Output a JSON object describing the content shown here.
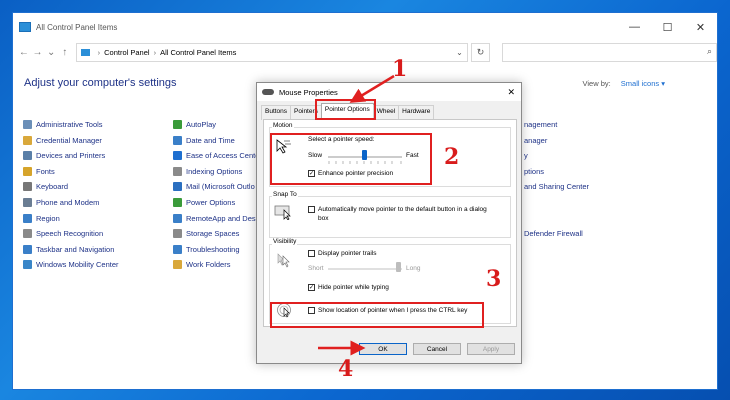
{
  "window": {
    "title": "All Control Panel Items"
  },
  "address": {
    "segments": [
      "Control Panel",
      "All Control Panel Items"
    ]
  },
  "main": {
    "heading": "Adjust your computer's settings",
    "view_by_label": "View by:",
    "view_by_value": "Small icons ▾",
    "col1": [
      "Administrative Tools",
      "Credential Manager",
      "Devices and Printers",
      "Fonts",
      "Keyboard",
      "Phone and Modem",
      "Region",
      "Speech Recognition",
      "Taskbar and Navigation",
      "Windows Mobility Center"
    ],
    "col2": [
      "AutoPlay",
      "Date and Time",
      "Ease of Access Center",
      "Indexing Options",
      "Mail (Microsoft Outlo",
      "Power Options",
      "RemoteApp and Desk",
      "Storage Spaces",
      "Troubleshooting",
      "Work Folders"
    ],
    "col_right": [
      "nagement",
      "anager",
      "y",
      "ptions",
      "and Sharing Center",
      "",
      "",
      "Defender Firewall"
    ]
  },
  "dialog": {
    "title": "Mouse Properties",
    "tabs": [
      "Buttons",
      "Pointers",
      "Pointer Options",
      "Wheel",
      "Hardware"
    ],
    "motion": {
      "label": "Motion",
      "speed_label": "Select a pointer speed:",
      "slow": "Slow",
      "fast": "Fast",
      "precision": "Enhance pointer precision"
    },
    "snap": {
      "label": "Snap To",
      "text1": "Automatically move pointer to the default button in a dialog",
      "text2": "box"
    },
    "visibility": {
      "label": "Visibility",
      "trails": "Display pointer trails",
      "short": "Short",
      "long": "Long",
      "hide": "Hide pointer while typing",
      "ctrl": "Show location of pointer when I press the CTRL key"
    },
    "buttons": {
      "ok": "OK",
      "cancel": "Cancel",
      "apply": "Apply"
    }
  },
  "annotations": {
    "n1": "1",
    "n2": "2",
    "n3": "3",
    "n4": "4"
  },
  "colors": {
    "accent": "#0a64c8",
    "annotation": "#e02020"
  }
}
